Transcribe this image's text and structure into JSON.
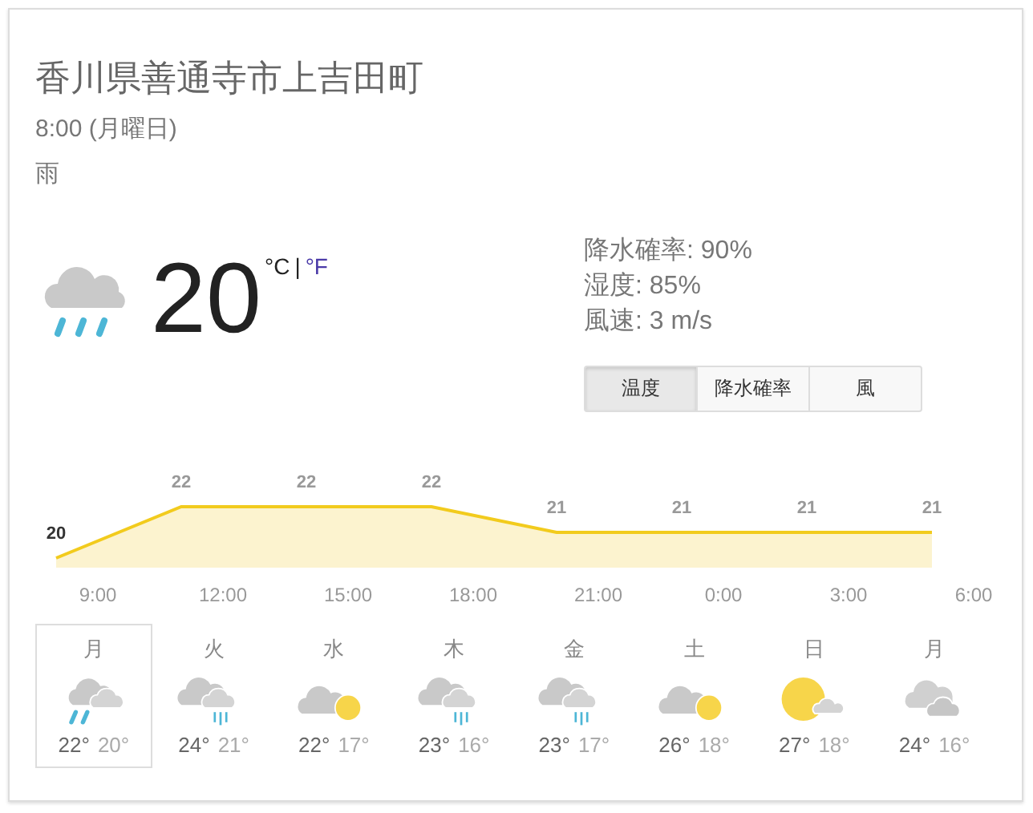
{
  "location": "香川県善通寺市上吉田町",
  "time": "8:00 (月曜日)",
  "condition": "雨",
  "current": {
    "kind": "rain",
    "temperature": "20",
    "unit_c": "°C",
    "separator": "|",
    "unit_f": "°F"
  },
  "details": [
    "降水確率: 90%",
    "湿度: 85%",
    "風速: 3 m/s"
  ],
  "tabs": [
    {
      "label": "温度",
      "selected": true
    },
    {
      "label": "降水確率",
      "selected": false
    },
    {
      "label": "風",
      "selected": false
    }
  ],
  "time_axis": [
    "9:00",
    "12:00",
    "15:00",
    "18:00",
    "21:00",
    "0:00",
    "3:00",
    "6:00"
  ],
  "chart_data": {
    "type": "area",
    "categories": [
      null,
      null,
      null,
      null,
      null,
      null,
      null,
      null
    ],
    "series": [
      {
        "color": "#f2cb1d",
        "values": [
          20,
          22,
          22,
          22,
          21,
          21,
          21,
          21
        ]
      }
    ],
    "data_labels": true
  },
  "days": [
    {
      "day": "月",
      "kind": "rain",
      "high": "22°",
      "low": "20°",
      "selected": true
    },
    {
      "day": "火",
      "kind": "showers",
      "high": "24°",
      "low": "21°",
      "selected": false
    },
    {
      "day": "水",
      "kind": "partly-sunny",
      "high": "22°",
      "low": "17°",
      "selected": false
    },
    {
      "day": "木",
      "kind": "showers",
      "high": "23°",
      "low": "16°",
      "selected": false
    },
    {
      "day": "金",
      "kind": "showers",
      "high": "23°",
      "low": "17°",
      "selected": false
    },
    {
      "day": "土",
      "kind": "partly-sunny",
      "high": "26°",
      "low": "18°",
      "selected": false
    },
    {
      "day": "日",
      "kind": "sunny",
      "high": "27°",
      "low": "18°",
      "selected": false
    },
    {
      "day": "月",
      "kind": "cloudy",
      "high": "24°",
      "low": "16°",
      "selected": false
    }
  ]
}
